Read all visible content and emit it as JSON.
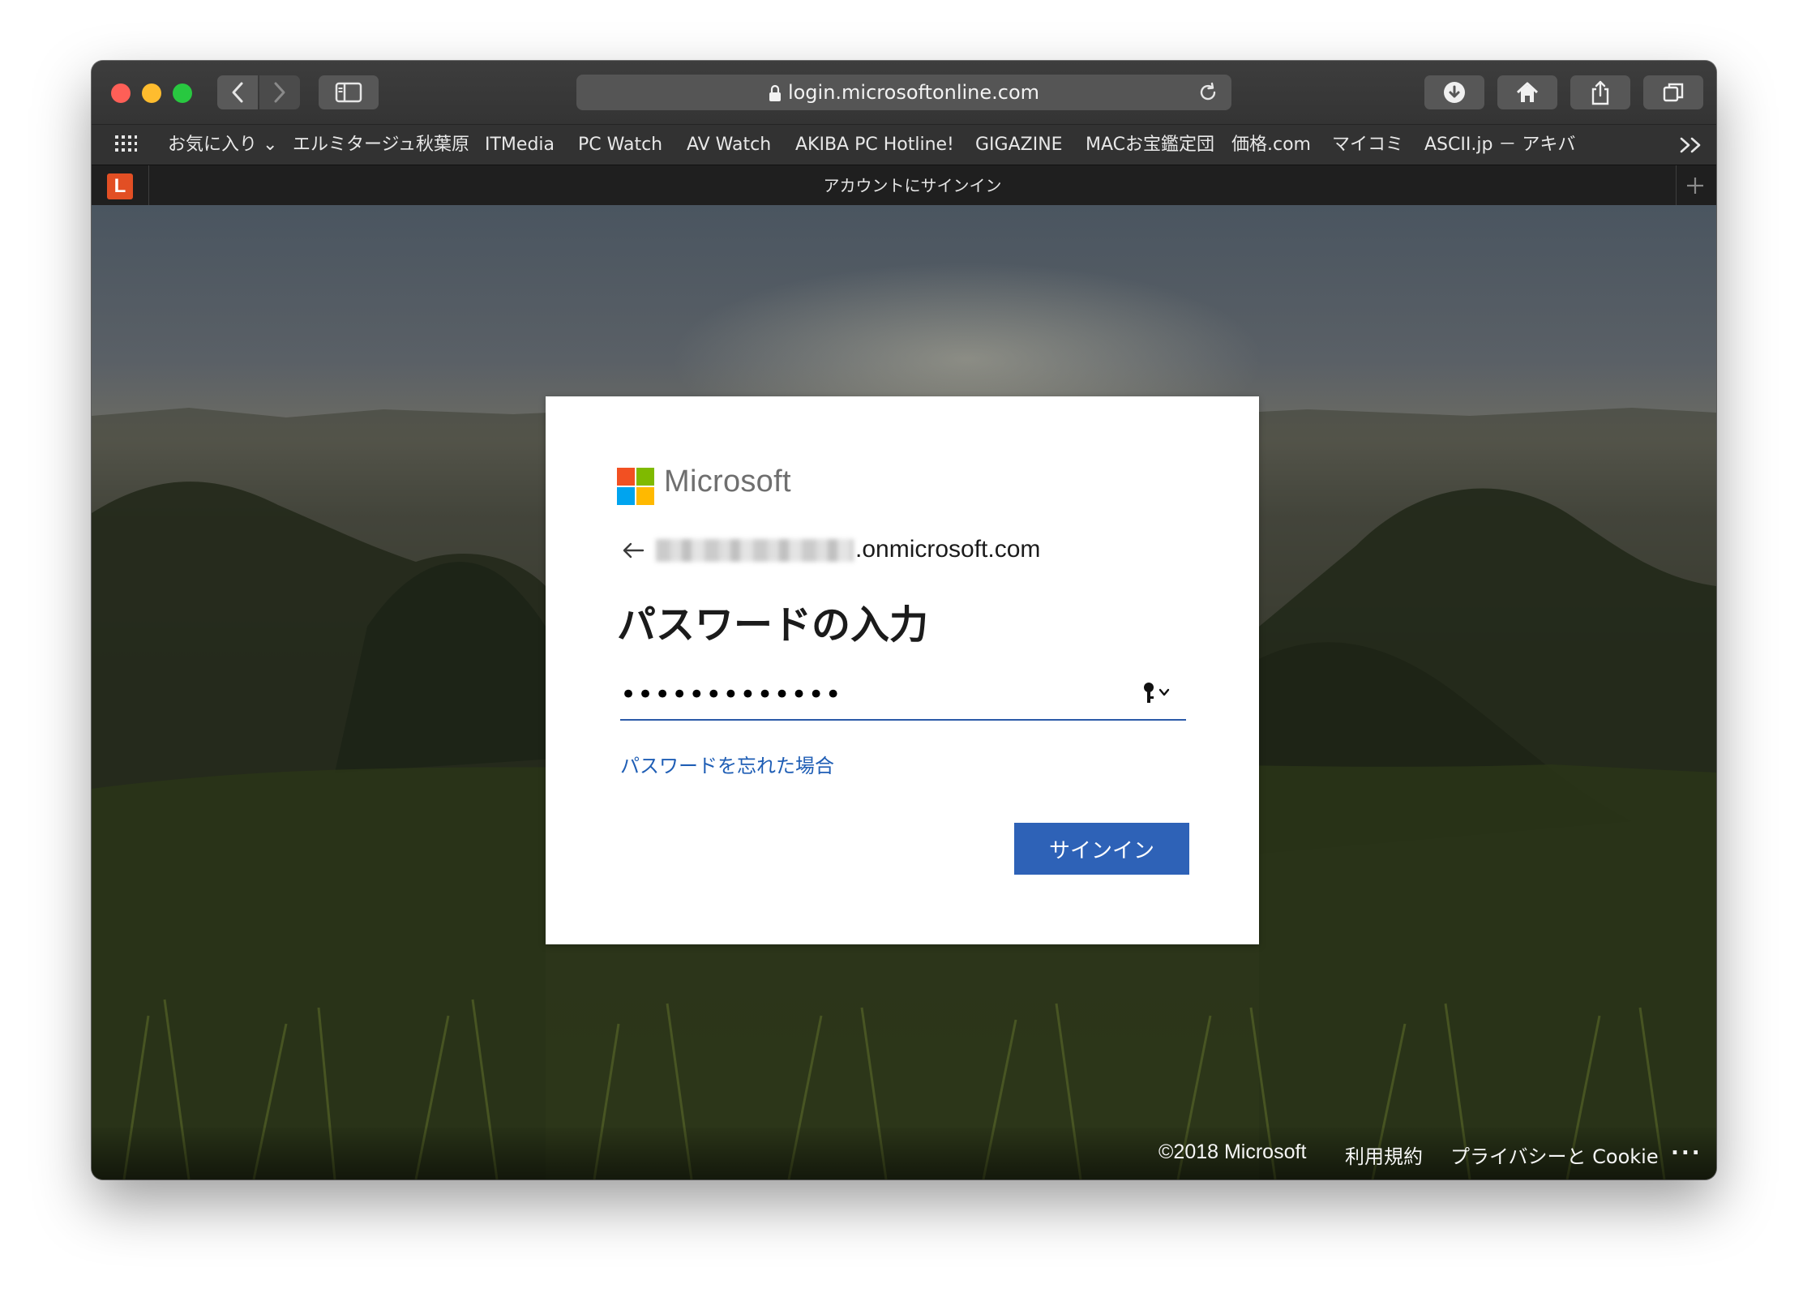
{
  "browser": {
    "address": "login.microsoftonline.com",
    "tab_title": "アカウントにサインイン",
    "tab_favicon_letter": "L"
  },
  "bookmarks": [
    {
      "label": "お気に入り ⌄"
    },
    {
      "label": "エルミタージュ秋葉原"
    },
    {
      "label": "ITMedia"
    },
    {
      "label": "PC Watch"
    },
    {
      "label": "AV Watch"
    },
    {
      "label": "AKIBA PC Hotline!"
    },
    {
      "label": "GIGAZINE"
    },
    {
      "label": "MACお宝鑑定団"
    },
    {
      "label": "価格.com"
    },
    {
      "label": "マイコミ"
    },
    {
      "label": "ASCII.jp － アキバ"
    }
  ],
  "signin": {
    "brand": "Microsoft",
    "identity_domain": ".onmicrosoft.com",
    "title": "パスワードの入力",
    "password_value": "•••••••••••••",
    "forgot_password": "パスワードを忘れた場合",
    "signin_button": "サインイン"
  },
  "footer": {
    "copyright": "©2018 Microsoft",
    "terms": "利用規約",
    "privacy": "プライバシーと Cookie",
    "more": "..."
  },
  "colors": {
    "accent_blue": "#2e62b7",
    "link_blue": "#1f5eb5",
    "ms_red": "#f25022",
    "ms_green": "#7fba00",
    "ms_blue": "#00a4ef",
    "ms_yellow": "#ffb900"
  }
}
